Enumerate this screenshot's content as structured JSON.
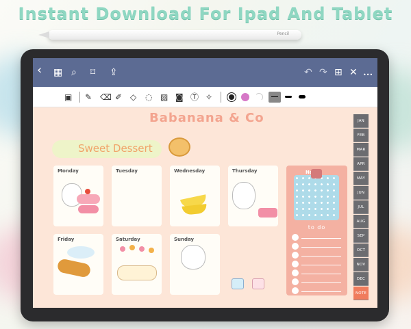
{
  "promo": {
    "title": "Instant Download For Ipad And Tablet"
  },
  "pencil": {
    "brand": "Pencil"
  },
  "app_toolbar": {
    "icons": [
      "back-icon",
      "grid-icon",
      "search-icon",
      "bookmark-icon",
      "share-icon",
      "undo-icon",
      "redo-icon",
      "add-page-icon",
      "close-icon",
      "more-icon"
    ],
    "glyphs": {
      "back": "‹",
      "grid": "▦",
      "search": "⌕",
      "bookmark": "⌑",
      "share": "⇪",
      "undo": "↶",
      "redo": "↷",
      "add_page": "⊞",
      "close": "✕",
      "more": "•••"
    }
  },
  "pen_toolbar": {
    "tools": [
      "page-tool-icon",
      "pen-icon",
      "eraser-icon",
      "highlighter-icon",
      "shapes-icon",
      "lasso-icon",
      "image-icon",
      "camera-icon",
      "text-icon",
      "laser-icon"
    ],
    "colors": [
      "#222222",
      "#d678c7"
    ]
  },
  "planner": {
    "brand_title": "Babanana & Co",
    "banner": "Sweet Dessert",
    "days": [
      "Monday",
      "Tuesday",
      "Wednesday",
      "Thursday",
      "Friday",
      "Saturday",
      "Sunday"
    ],
    "todo_header": "No",
    "todo_label": "to do"
  },
  "tabs": [
    "JAN",
    "FEB",
    "MAR",
    "APR",
    "MAY",
    "JUN",
    "JUL",
    "AUG",
    "SEP",
    "OCT",
    "NOV",
    "DEC",
    "NOTE"
  ]
}
